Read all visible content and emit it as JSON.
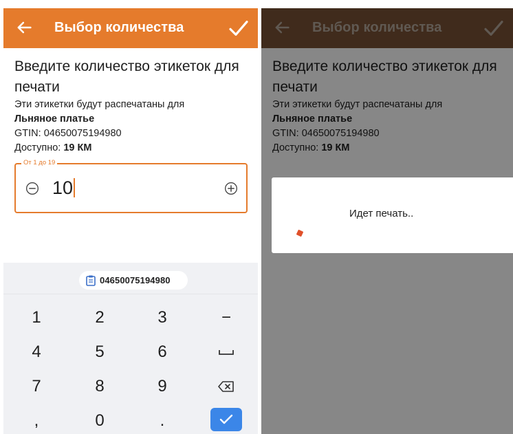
{
  "left_screen": {
    "appbar": {
      "title": "Выбор количества"
    },
    "heading": "Введите количество этикеток для печати",
    "subtitle": "Эти этикетки будут распечатаны для",
    "product_name": "Льняное платье",
    "gtin_label": "GTIN:",
    "gtin_value": "04650075194980",
    "available_label": "Доступно:",
    "available_value": "19 КМ",
    "quantity_field": {
      "legend": "От 1 до 19",
      "value": "10"
    },
    "keyboard": {
      "suggestion": "04650075194980",
      "keys": [
        "1",
        "2",
        "3",
        "−",
        "4",
        "5",
        "6",
        "space",
        "7",
        "8",
        "9",
        "backspace",
        ",",
        "0",
        ".",
        "done"
      ]
    },
    "accent_color": "#e57b2c"
  },
  "right_screen": {
    "appbar": {
      "title": "Выбор количества"
    },
    "heading": "Введите количество этикеток для печати",
    "subtitle": "Эти этикетки будут распечатаны для",
    "product_name": "Льняное платье",
    "gtin_label": "GTIN:",
    "gtin_value": "04650075194980",
    "available_label": "Доступно:",
    "available_value": "19 КМ",
    "dialog": {
      "message": "Идет печать.."
    }
  }
}
